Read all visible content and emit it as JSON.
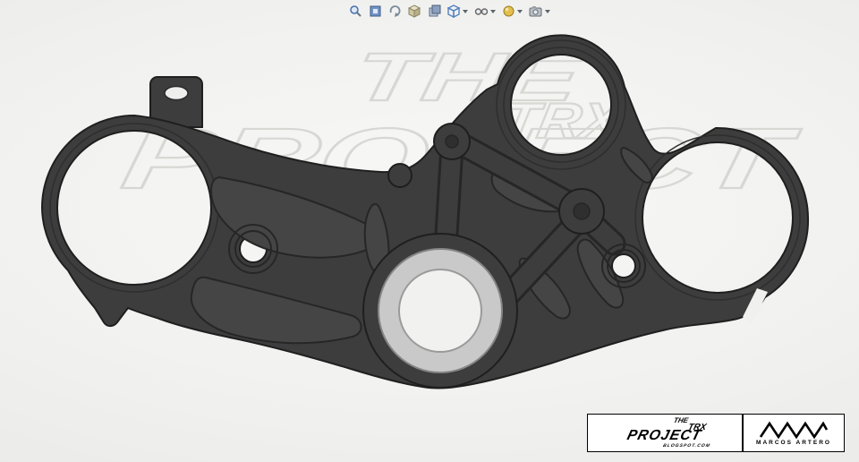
{
  "colors": {
    "part": "#3d3d3d",
    "part_outline": "#1f1f1f",
    "pocket": "#454545",
    "pocket_line": "#262626",
    "ring_light": "#c9c9c9",
    "watermark": "#d7d7d4"
  },
  "toolbar": {
    "icons": [
      {
        "name": "zoom-icon",
        "dropdown": false
      },
      {
        "name": "view-orientation-icon",
        "dropdown": false
      },
      {
        "name": "rotate-view-icon",
        "dropdown": false
      },
      {
        "name": "isometric-view-icon",
        "dropdown": false
      },
      {
        "name": "appearance-stack-icon",
        "dropdown": false
      },
      {
        "name": "display-style-icon",
        "dropdown": true
      },
      {
        "name": "hide-show-items-icon",
        "dropdown": true
      },
      {
        "name": "edit-appearance-icon",
        "dropdown": true
      },
      {
        "name": "view-settings-icon",
        "dropdown": true
      }
    ]
  },
  "watermark": {
    "the": "THE",
    "trx": "TRX",
    "project": "PROJECT",
    "blogspot": "BLOGSPOT.COM"
  },
  "logo_plate": {
    "the": "THE",
    "trx": "TRX",
    "project": "PROJECT",
    "blogspot": "BLOGSPOT.COM",
    "brand": "MARCOS ARTERO"
  }
}
